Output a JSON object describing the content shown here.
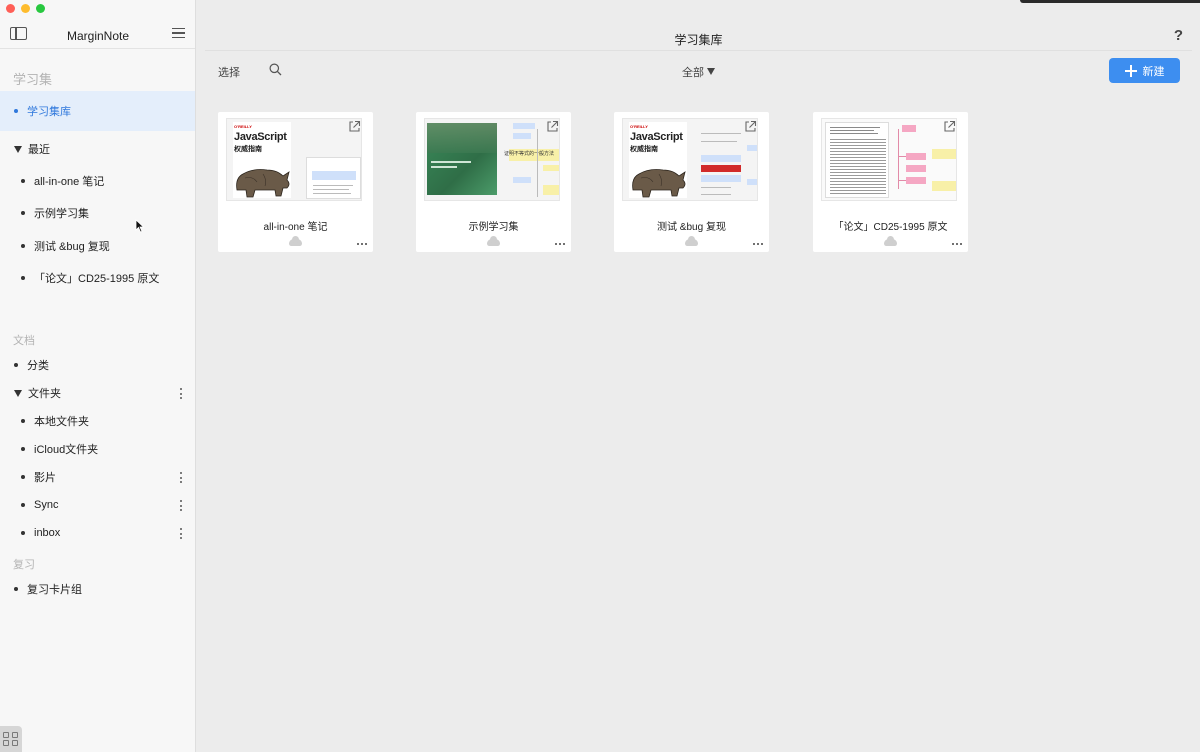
{
  "app": {
    "name": "MarginNote",
    "page_title": "学习集库"
  },
  "sidebar": {
    "section_study": "学习集",
    "study_library": "学习集库",
    "recent_label": "最近",
    "recent_items": [
      "all-in-one 笔记",
      "示例学习集",
      "测试 &bug 复现",
      "「论文」CD25-1995 原文"
    ],
    "section_docs": "文档",
    "categories_label": "分类",
    "folders_label": "文件夹",
    "folder_items": [
      "本地文件夹",
      "iCloud文件夹",
      "影片",
      "Sync",
      "inbox"
    ],
    "section_review": "复习",
    "review_item": "复习卡片组"
  },
  "toolbar": {
    "select_label": "选择",
    "filter_label": "全部",
    "new_label": "新建",
    "help_label": "?"
  },
  "cards": [
    {
      "title": "all-in-one 笔记",
      "thumbnail": "oreilly-javascript-mindmap"
    },
    {
      "title": "示例学习集",
      "thumbnail": "green-book-mindmap"
    },
    {
      "title": "测试 &bug 复现",
      "thumbnail": "oreilly-javascript-outline"
    },
    {
      "title": "「论文」CD25-1995 原文",
      "thumbnail": "paper-mindmap"
    }
  ],
  "thumbnail_text": {
    "oreilly_brand": "O'REILLY",
    "oreilly_title": "JavaScript",
    "oreilly_subtitle": "权威指南",
    "green_book_text": "证明不等式的一般方法"
  },
  "colors": {
    "accent": "#3d8ef0",
    "active_bg": "#e4eefb",
    "active_text": "#2f78dc"
  }
}
